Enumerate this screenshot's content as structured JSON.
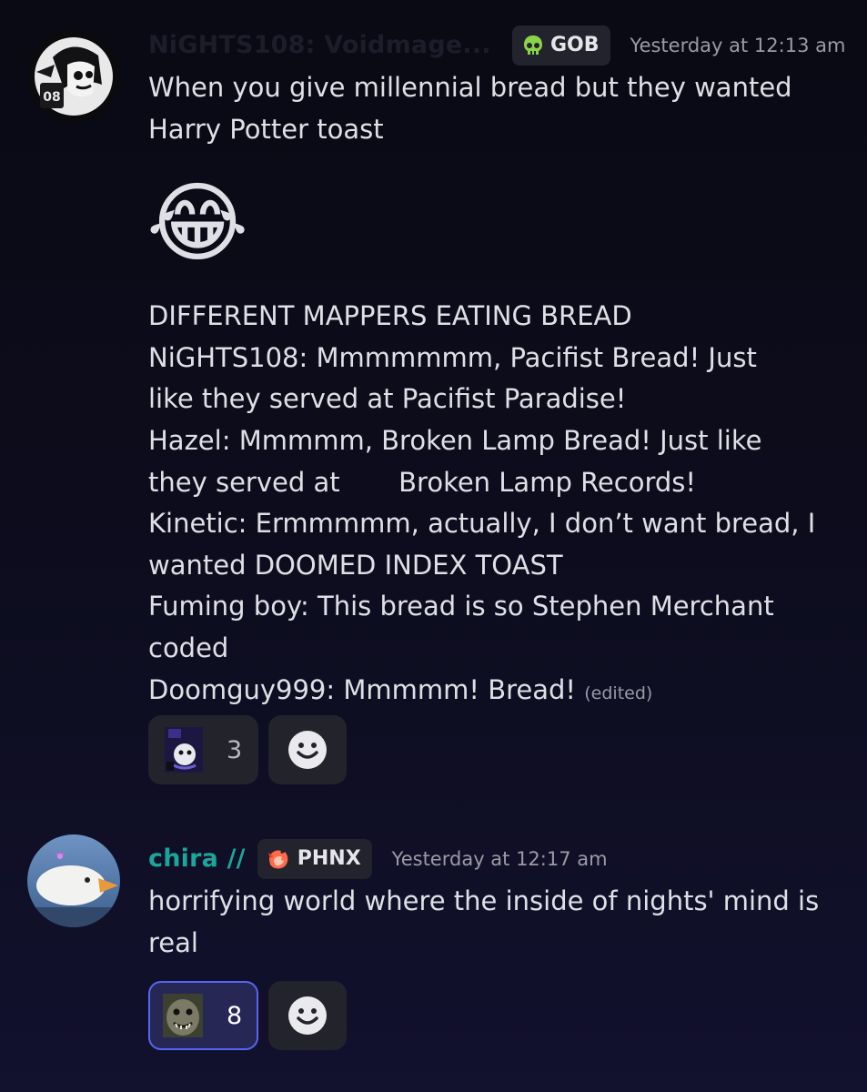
{
  "messages": [
    {
      "username": "NiGHTS108: Voidmage...",
      "tag": {
        "label": "GOB",
        "icon": "skull-icon"
      },
      "timestamp": "Yesterday at 12:13 am",
      "content": {
        "line1": "When you give millennial bread but they wanted",
        "line2": "Harry Potter toast",
        "emoji": "😂",
        "lines": [
          "DIFFERENT MAPPERS EATING BREAD",
          "NiGHTS108: Mmmmmmm, Pacifist Bread! Just",
          "like they served at Pacifist Paradise!",
          "Hazel: Mmmmm, Broken Lamp Bread! Just like",
          "they served at       Broken Lamp Records!",
          "Kinetic: Ermmmmm, actually, I don’t want bread, I",
          "wanted DOOMED INDEX TOAST",
          "Fuming boy: This bread is so Stephen Merchant",
          "coded",
          "Doomguy999: Mmmmm! Bread! "
        ],
        "edited": "(edited)"
      },
      "reaction": {
        "emoji": "custom-ghost-emoji",
        "count": "3"
      }
    },
    {
      "username": "chira //",
      "username_color": "#1aa698",
      "tag": {
        "label": "PHNX",
        "icon": "phoenix-icon"
      },
      "timestamp": "Yesterday at 12:17 am",
      "content": {
        "line1": "horrifying world where the inside of nights' mind is",
        "line2": "real"
      },
      "reaction": {
        "emoji": "custom-seal-emoji",
        "count": "8"
      }
    }
  ],
  "colors": {
    "accent": "#5865f2",
    "tag_background": "#23232d",
    "timestamp": "#9a9ba4"
  }
}
